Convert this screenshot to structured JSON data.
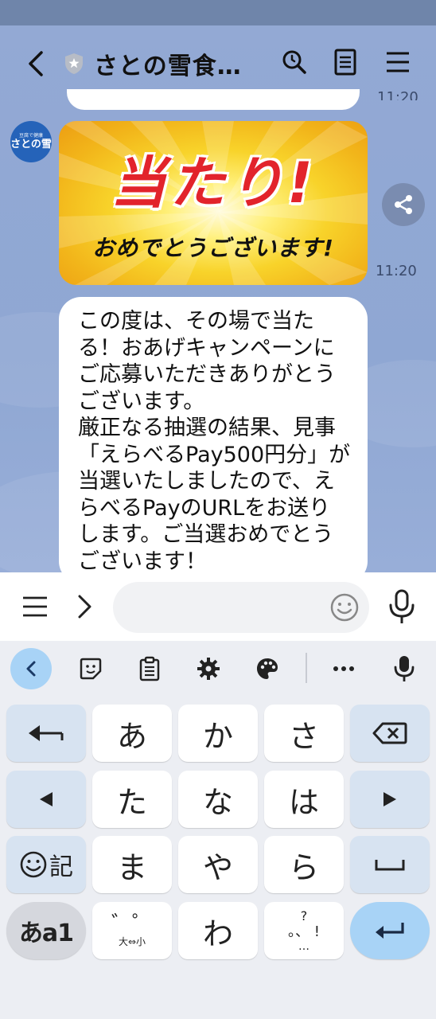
{
  "header": {
    "title": "さとの雪食…"
  },
  "chat": {
    "prev_time": "11:20",
    "avatar": {
      "small_text": "豆腐で健康",
      "big_text": "さとの雪"
    },
    "image_message": {
      "headline": "当たり!",
      "subline": "おめでとうございます!",
      "time": "11:20"
    },
    "text_message": "この度は、その場で当たる！おあげキャンペーンにご応募いただきありがとうございます。\n厳正なる抽選の結果、見事「えらべるPay500円分」が当選いたしましたので、えらべるPayのURLをお送りします。ご当選おめでとうございます！"
  },
  "input": {
    "value": "",
    "placeholder": ""
  },
  "keyboard": {
    "rows": [
      [
        "あ",
        "か",
        "さ"
      ],
      [
        "た",
        "な",
        "は"
      ],
      [
        "ま",
        "や",
        "ら"
      ],
      [
        "",
        "わ",
        ""
      ]
    ],
    "emoji_key_label": "記",
    "mode_key_label": "あa1",
    "dakuten_key": {
      "top": "゛゜",
      "bottom": "大⇔小"
    },
    "punct_key": {
      "top": "?",
      "middle": "。、 !",
      "bottom": "…"
    }
  },
  "colors": {
    "chat_background": "#93a9d4",
    "accent_blue": "#a8d3f6",
    "atari_red": "#e2232b",
    "avatar_blue": "#2563b9"
  },
  "icons": [
    "back-icon",
    "shield-icon",
    "search-icon",
    "notes-icon",
    "menu-icon",
    "share-icon",
    "hamburger-icon",
    "chevron-right-icon",
    "emoji-icon",
    "mic-icon",
    "sticker-icon",
    "clipboard-icon",
    "gear-icon",
    "palette-icon",
    "more-icon",
    "undo-icon",
    "backspace-icon",
    "left-arrow-icon",
    "right-arrow-icon",
    "space-icon",
    "enter-icon"
  ]
}
